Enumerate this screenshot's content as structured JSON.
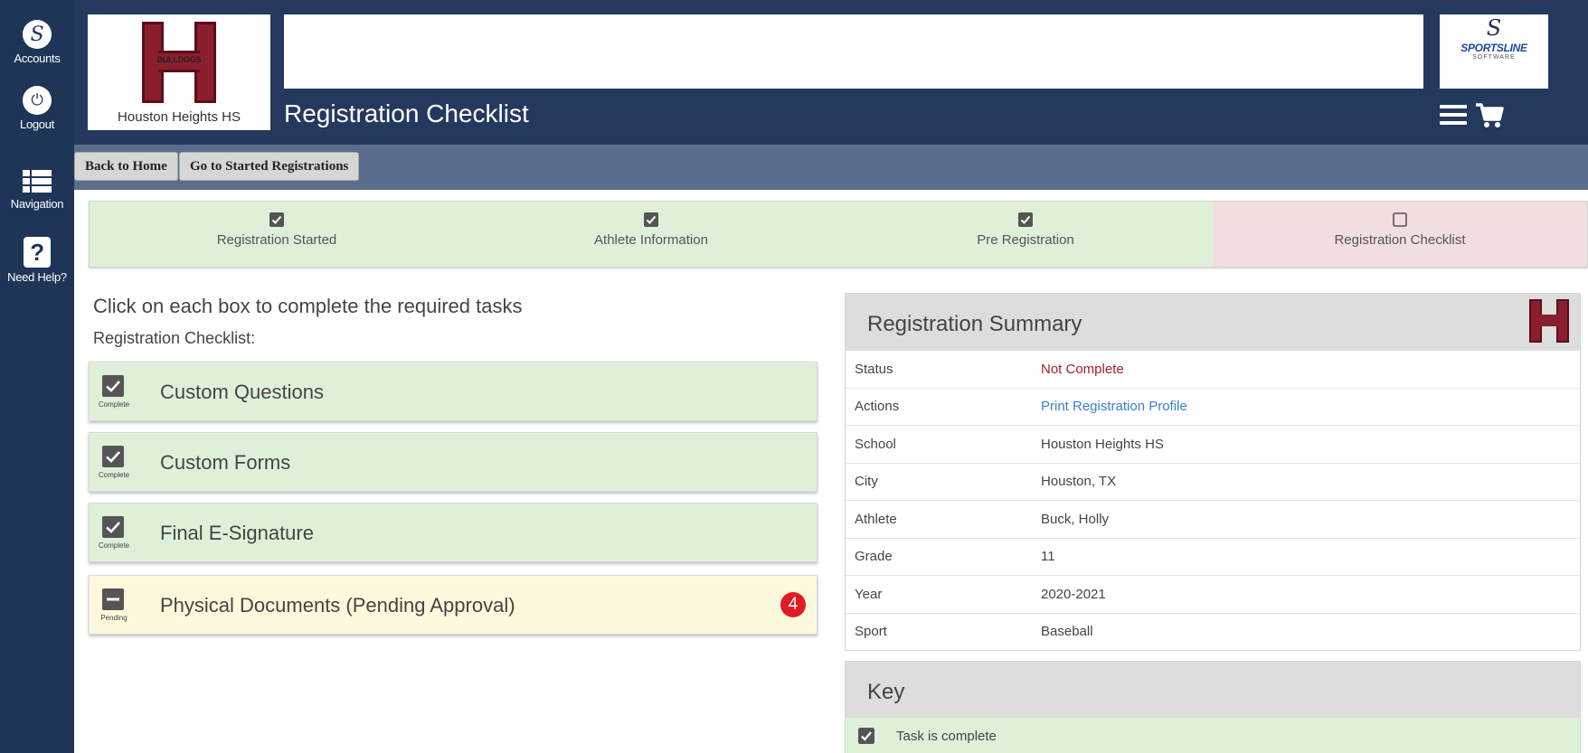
{
  "sidebar": {
    "accounts": "Accounts",
    "logout": "Logout",
    "navigation": "Navigation",
    "help": "Need Help?",
    "help_glyph": "?"
  },
  "header": {
    "school_logo_text": "BULLDOGS",
    "school_name": "Houston Heights HS",
    "page_title": "Registration Checklist",
    "brand_name": "SPORTSLINE",
    "brand_sub": "SOFTWARE"
  },
  "buttons": {
    "back_home": "Back to Home",
    "started_regs": "Go to Started Registrations"
  },
  "steps": [
    {
      "label": "Registration Started",
      "done": true
    },
    {
      "label": "Athlete Information",
      "done": true
    },
    {
      "label": "Pre Registration",
      "done": true
    },
    {
      "label": "Registration Checklist",
      "done": false
    }
  ],
  "checklist": {
    "intro": "Click on each box to complete the required tasks",
    "subtitle": "Registration Checklist:",
    "tasks": [
      {
        "title": "Custom Questions",
        "state": "Complete"
      },
      {
        "title": "Custom Forms",
        "state": "Complete"
      },
      {
        "title": "Final E-Signature",
        "state": "Complete"
      },
      {
        "title": "Physical Documents (Pending Approval)",
        "state": "Pending",
        "badge": "4"
      }
    ]
  },
  "summary": {
    "title": "Registration Summary",
    "rows": [
      {
        "label": "Status",
        "value": "Not Complete"
      },
      {
        "label": "Actions",
        "value": "Print Registration Profile"
      },
      {
        "label": "School",
        "value": "Houston Heights HS"
      },
      {
        "label": "City",
        "value": "Houston, TX"
      },
      {
        "label": "Athlete",
        "value": "Buck, Holly"
      },
      {
        "label": "Grade",
        "value": "11"
      },
      {
        "label": "Year",
        "value": "2020-2021"
      },
      {
        "label": "Sport",
        "value": "Baseball"
      }
    ]
  },
  "key": {
    "title": "Key",
    "items": [
      {
        "label": "Task is complete"
      }
    ]
  },
  "colors": {
    "sidebar": "#1f3558",
    "header": "#24395d",
    "complete_bg": "#dff0d8",
    "pending_bg": "#fcf8dc",
    "current_bg": "#f2dede",
    "school_red": "#8b1e2e",
    "badge_red": "#e01b24",
    "link_blue": "#3a7fd0"
  }
}
